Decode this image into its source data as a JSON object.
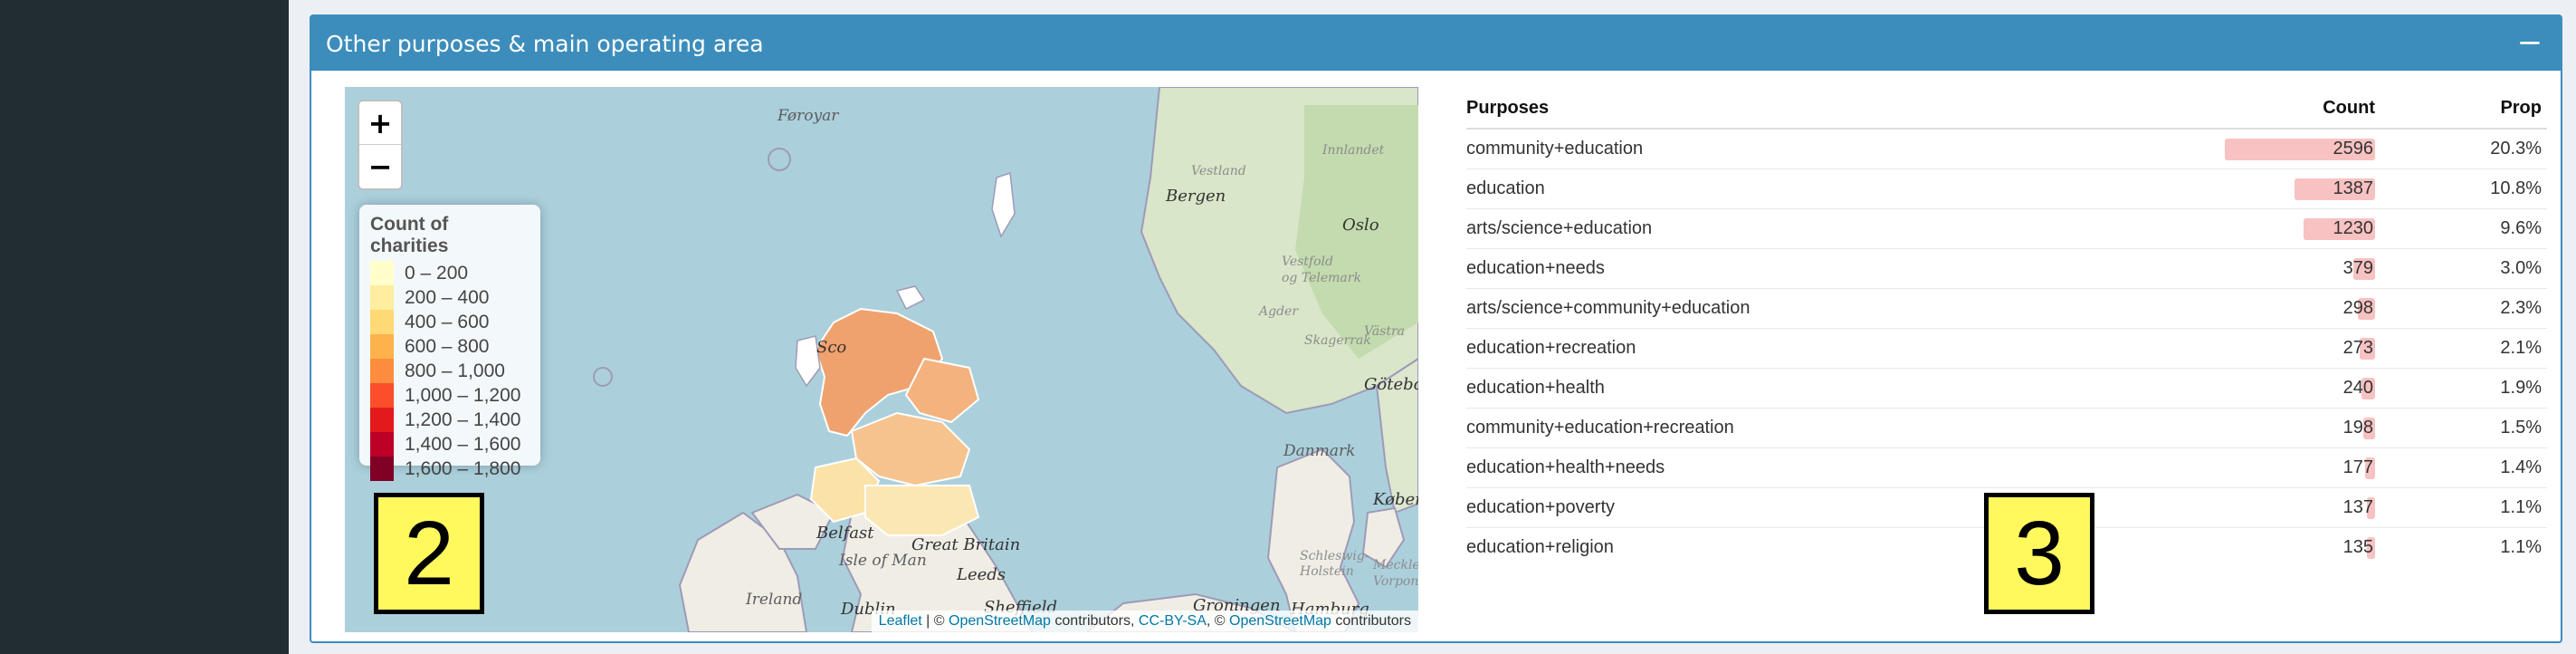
{
  "box": {
    "title": "Other purposes & main operating area",
    "collapse_symbol": "−"
  },
  "map": {
    "zoom_in": "+",
    "zoom_out": "−",
    "legend": {
      "title": "Count of charities",
      "items": [
        {
          "label": "0 – 200",
          "color": "#ffffcc"
        },
        {
          "label": "200 – 400",
          "color": "#ffeda0"
        },
        {
          "label": "400 – 600",
          "color": "#fed976"
        },
        {
          "label": "600 – 800",
          "color": "#feb24c"
        },
        {
          "label": "800 – 1,000",
          "color": "#fd8d3c"
        },
        {
          "label": "1,000 – 1,200",
          "color": "#fc4e2a"
        },
        {
          "label": "1,200 – 1,400",
          "color": "#e31a1c"
        },
        {
          "label": "1,400 – 1,600",
          "color": "#bd0026"
        },
        {
          "label": "1,600 – 1,800",
          "color": "#800026"
        }
      ]
    },
    "places": {
      "faroe": "Føroyar",
      "bergen": "Bergen",
      "vestland": "Vestland",
      "innlandet": "Innlandet",
      "oslo": "Oslo",
      "vestfold": "Vestfold",
      "og_telemark": "og Telemark",
      "agder": "Agder",
      "skagerrak": "Skagerrak",
      "vastra": "Västra",
      "goteborg": "Götebor",
      "danmark": "Danmark",
      "kobenhavn": "Køben",
      "schleswig": "Schleswig-",
      "holstein": "Holstein",
      "vorpom": "Vorpon",
      "meckl": "Meckle",
      "belfast": "Belfast",
      "isle_of_man": "Isle of Man",
      "great_britain": "Great Britain",
      "leeds": "Leeds",
      "ireland": "Ireland",
      "dublin": "Dublin",
      "sheffield": "Sheffield",
      "groningen": "Groningen",
      "hamburg": "Hamburg",
      "scot_label": "Sco"
    },
    "attribution": {
      "leaflet": "Leaflet",
      "sep": " | © ",
      "osm1": "OpenStreetMap",
      "contrib1": " contributors, ",
      "license": "CC-BY-SA",
      "sep2": ", © ",
      "osm2": "OpenStreetMap",
      "contrib2": " contributors"
    }
  },
  "markers": {
    "map_marker": "2",
    "table_marker": "3"
  },
  "table": {
    "headers": {
      "purposes": "Purposes",
      "count": "Count",
      "prop": "Prop"
    },
    "max_count": 2596,
    "bar_color": "#f7c2c1",
    "rows": [
      {
        "purpose": "community+education",
        "count": 2596,
        "prop": "20.3%"
      },
      {
        "purpose": "education",
        "count": 1387,
        "prop": "10.8%"
      },
      {
        "purpose": "arts/science+education",
        "count": 1230,
        "prop": "9.6%"
      },
      {
        "purpose": "education+needs",
        "count": 379,
        "prop": "3.0%"
      },
      {
        "purpose": "arts/science+community+education",
        "count": 298,
        "prop": "2.3%"
      },
      {
        "purpose": "education+recreation",
        "count": 273,
        "prop": "2.1%"
      },
      {
        "purpose": "education+health",
        "count": 240,
        "prop": "1.9%"
      },
      {
        "purpose": "community+education+recreation",
        "count": 198,
        "prop": "1.5%"
      },
      {
        "purpose": "education+health+needs",
        "count": 177,
        "prop": "1.4%"
      },
      {
        "purpose": "education+poverty",
        "count": 137,
        "prop": "1.1%"
      },
      {
        "purpose": "education+religion",
        "count": 135,
        "prop": "1.1%"
      }
    ]
  }
}
